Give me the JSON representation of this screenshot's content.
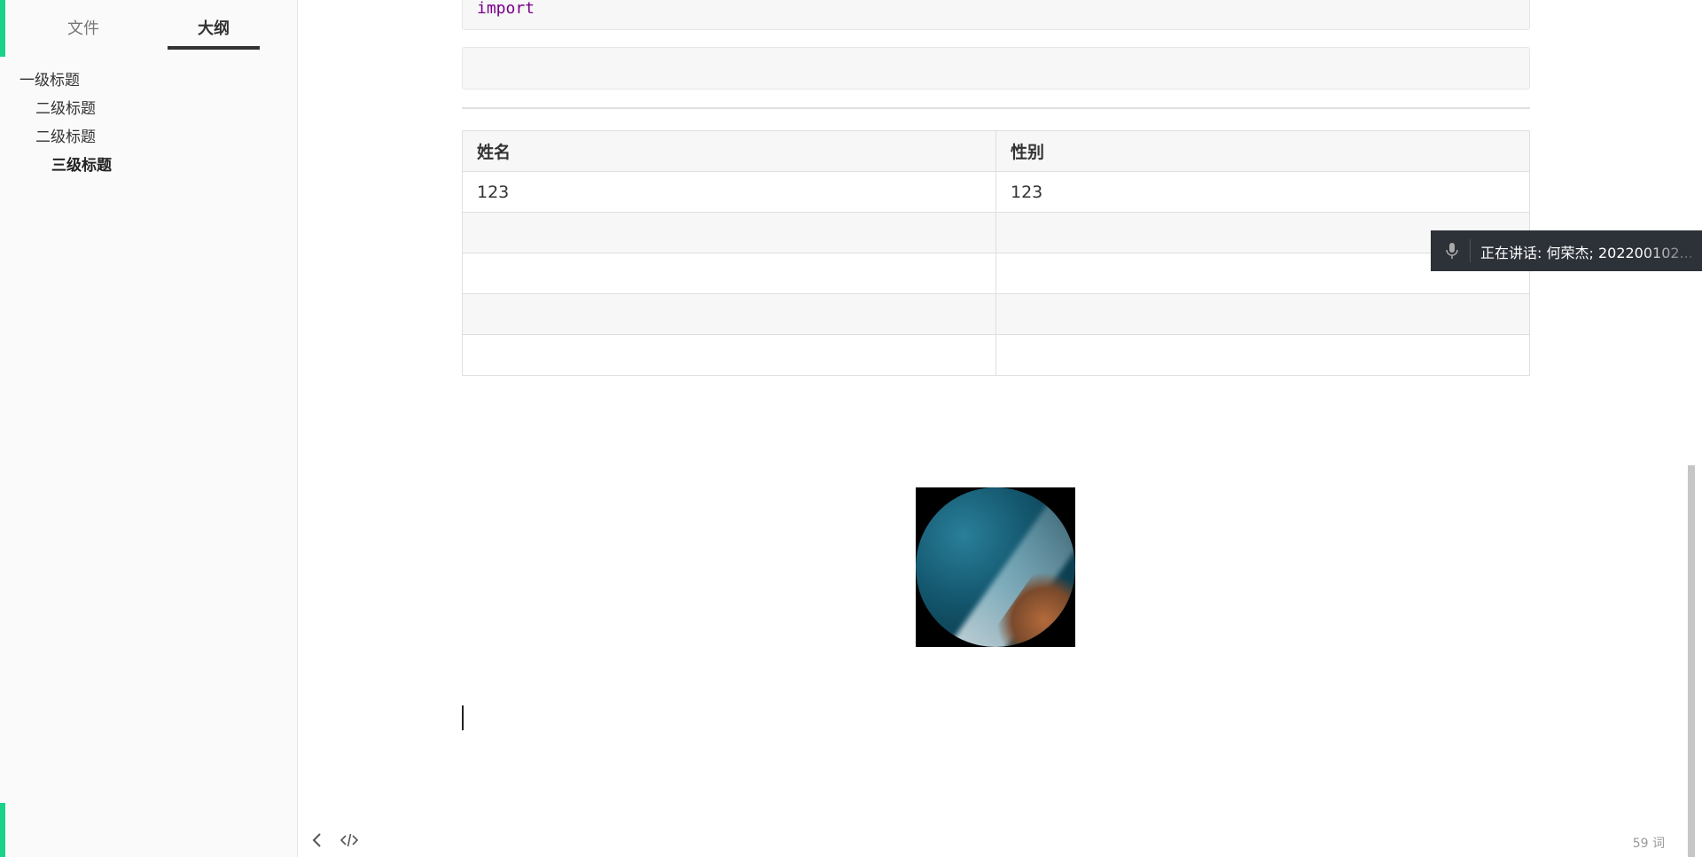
{
  "sidebar": {
    "tabs": [
      {
        "label": "文件"
      },
      {
        "label": "大纲"
      }
    ],
    "outline": [
      {
        "label": "一级标题",
        "level": 1
      },
      {
        "label": "二级标题",
        "level": 2
      },
      {
        "label": "二级标题",
        "level": 2
      },
      {
        "label": "三级标题",
        "level": 3
      }
    ]
  },
  "editor": {
    "code_block_1": "import",
    "code_block_2": "",
    "table": {
      "headers": [
        "姓名",
        "性别"
      ],
      "rows": [
        [
          "123",
          "123"
        ],
        [
          "",
          ""
        ],
        [
          "",
          ""
        ],
        [
          "",
          ""
        ],
        [
          "",
          ""
        ]
      ]
    }
  },
  "footer": {
    "word_count": "59 词"
  },
  "notification": {
    "text": "正在讲话: 何荣杰; 202200102..."
  },
  "colors": {
    "accent": "#1bd28a",
    "code_keyword": "#770088"
  }
}
